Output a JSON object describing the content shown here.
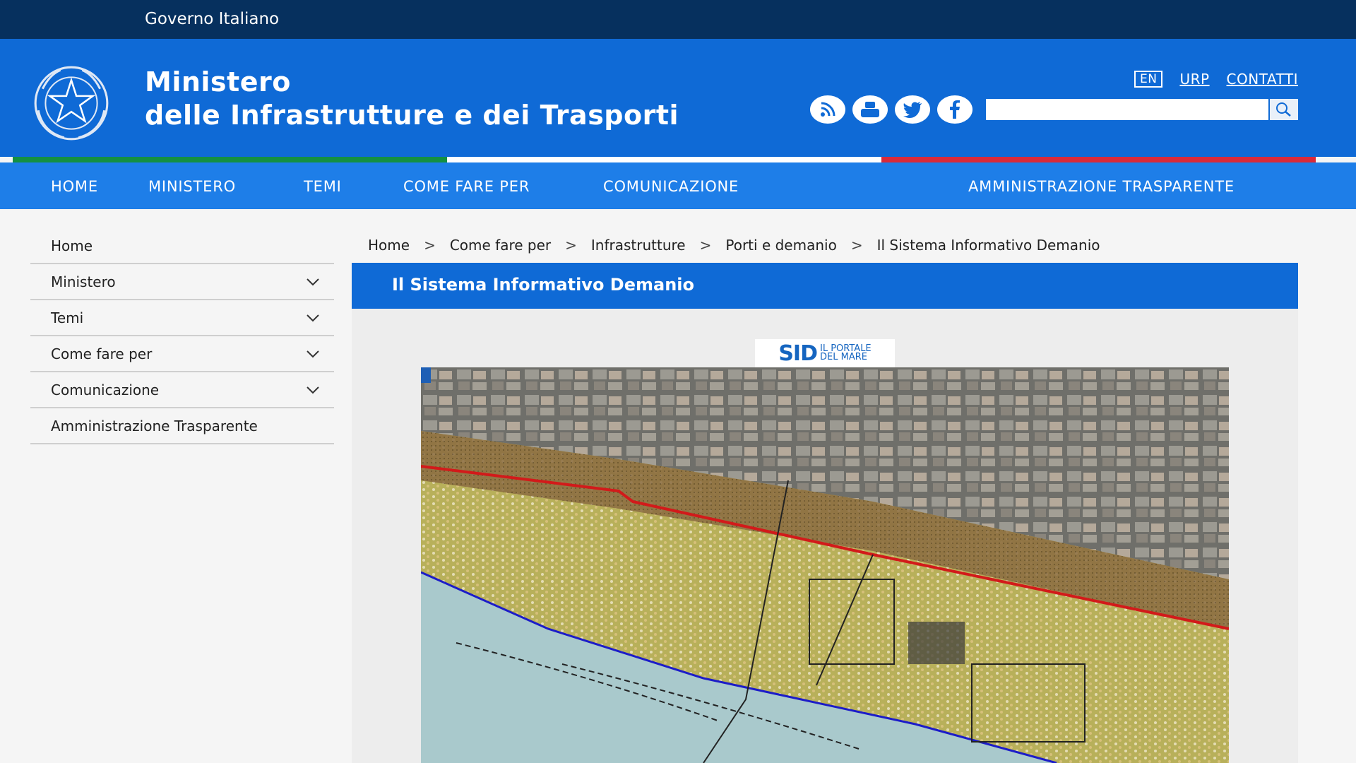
{
  "topbar": {
    "gov": "Governo Italiano"
  },
  "header": {
    "title_line1": "Ministero",
    "title_line2": "delle Infrastrutture e dei Trasporti",
    "links": {
      "en": "EN",
      "urp": "URP",
      "contatti": "CONTATTI"
    },
    "socials": [
      "rss-icon",
      "youtube-icon",
      "twitter-icon",
      "facebook-icon"
    ],
    "search_placeholder": ""
  },
  "nav": {
    "home": "HOME",
    "ministero": "MINISTERO",
    "temi": "TEMI",
    "come_fare_per": "COME FARE PER",
    "comunicazione": "COMUNICAZIONE",
    "amministrazione": "AMMINISTRAZIONE TRASPARENTE"
  },
  "sidebar": {
    "items": [
      {
        "label": "Home"
      },
      {
        "label": "Ministero"
      },
      {
        "label": "Temi"
      },
      {
        "label": "Come fare per"
      },
      {
        "label": "Comunicazione"
      },
      {
        "label": "Amministrazione Trasparente"
      }
    ]
  },
  "breadcrumb": {
    "items": [
      "Home",
      "Come fare per",
      "Infrastrutture",
      "Porti e demanio",
      "Il Sistema Informativo Demanio"
    ],
    "sep": ">"
  },
  "content": {
    "title": "Il Sistema Informativo Demanio",
    "logo_big": "SID",
    "logo_small_1": "IL PORTALE",
    "logo_small_2": "DEL MARE"
  },
  "colors": {
    "topbar": "#06305e",
    "header": "#0f6ad6",
    "nav": "#1e7ee8",
    "flag_green": "#149042",
    "flag_red": "#d92a3a"
  }
}
